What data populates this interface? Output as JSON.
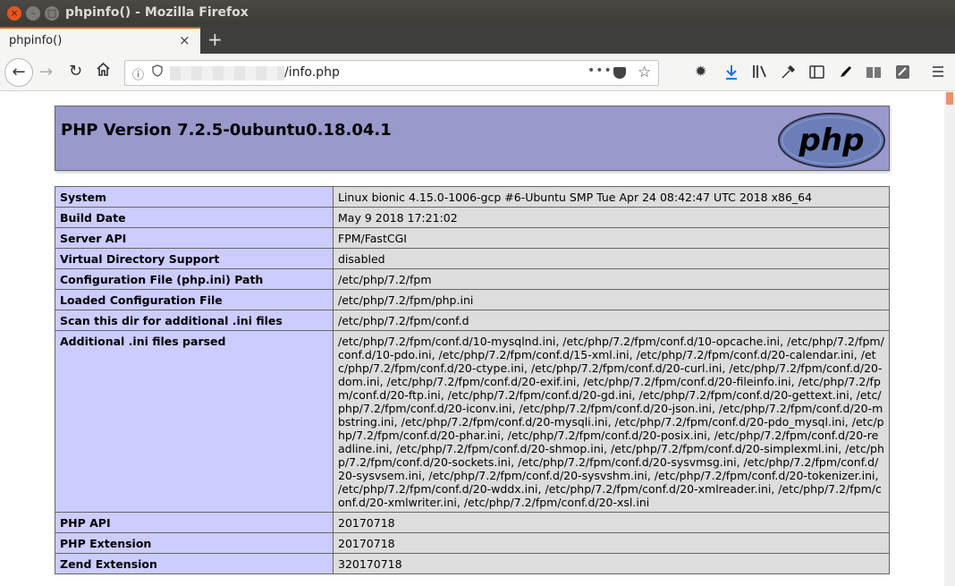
{
  "window": {
    "title": "phpinfo() - Mozilla Firefox",
    "close_glyph": "×",
    "min_glyph": "–",
    "max_glyph": "□"
  },
  "tab": {
    "label": "phpinfo()",
    "close_glyph": "×",
    "new_tab_glyph": "+"
  },
  "nav": {
    "url_visible": "/info.php",
    "more_glyph": "•••"
  },
  "page": {
    "version_title": "PHP Version 7.2.5-0ubuntu0.18.04.1",
    "logo_text": "php",
    "rows": [
      {
        "key": "System",
        "value": "Linux bionic 4.15.0-1006-gcp #6-Ubuntu SMP Tue Apr 24 08:42:47 UTC 2018 x86_64"
      },
      {
        "key": "Build Date",
        "value": "May 9 2018 17:21:02"
      },
      {
        "key": "Server API",
        "value": "FPM/FastCGI"
      },
      {
        "key": "Virtual Directory Support",
        "value": "disabled"
      },
      {
        "key": "Configuration File (php.ini) Path",
        "value": "/etc/php/7.2/fpm"
      },
      {
        "key": "Loaded Configuration File",
        "value": "/etc/php/7.2/fpm/php.ini"
      },
      {
        "key": "Scan this dir for additional .ini files",
        "value": "/etc/php/7.2/fpm/conf.d"
      },
      {
        "key": "Additional .ini files parsed",
        "value": "/etc/php/7.2/fpm/conf.d/10-mysqlnd.ini, /etc/php/7.2/fpm/conf.d/10-opcache.ini, /etc/php/7.2/fpm/conf.d/10-pdo.ini, /etc/php/7.2/fpm/conf.d/15-xml.ini, /etc/php/7.2/fpm/conf.d/20-calendar.ini, /etc/php/7.2/fpm/conf.d/20-ctype.ini, /etc/php/7.2/fpm/conf.d/20-curl.ini, /etc/php/7.2/fpm/conf.d/20-dom.ini, /etc/php/7.2/fpm/conf.d/20-exif.ini, /etc/php/7.2/fpm/conf.d/20-fileinfo.ini, /etc/php/7.2/fpm/conf.d/20-ftp.ini, /etc/php/7.2/fpm/conf.d/20-gd.ini, /etc/php/7.2/fpm/conf.d/20-gettext.ini, /etc/php/7.2/fpm/conf.d/20-iconv.ini, /etc/php/7.2/fpm/conf.d/20-json.ini, /etc/php/7.2/fpm/conf.d/20-mbstring.ini, /etc/php/7.2/fpm/conf.d/20-mysqli.ini, /etc/php/7.2/fpm/conf.d/20-pdo_mysql.ini, /etc/php/7.2/fpm/conf.d/20-phar.ini, /etc/php/7.2/fpm/conf.d/20-posix.ini, /etc/php/7.2/fpm/conf.d/20-readline.ini, /etc/php/7.2/fpm/conf.d/20-shmop.ini, /etc/php/7.2/fpm/conf.d/20-simplexml.ini, /etc/php/7.2/fpm/conf.d/20-sockets.ini, /etc/php/7.2/fpm/conf.d/20-sysvmsg.ini, /etc/php/7.2/fpm/conf.d/20-sysvsem.ini, /etc/php/7.2/fpm/conf.d/20-sysvshm.ini, /etc/php/7.2/fpm/conf.d/20-tokenizer.ini, /etc/php/7.2/fpm/conf.d/20-wddx.ini, /etc/php/7.2/fpm/conf.d/20-xmlreader.ini, /etc/php/7.2/fpm/conf.d/20-xmlwriter.ini, /etc/php/7.2/fpm/conf.d/20-xsl.ini"
      },
      {
        "key": "PHP API",
        "value": "20170718"
      },
      {
        "key": "PHP Extension",
        "value": "20170718"
      },
      {
        "key": "Zend Extension",
        "value": "320170718"
      }
    ]
  },
  "colors": {
    "accent": "#e95420",
    "header_bg": "#9999cc",
    "key_bg": "#ccccff",
    "value_bg": "#dddddd"
  }
}
